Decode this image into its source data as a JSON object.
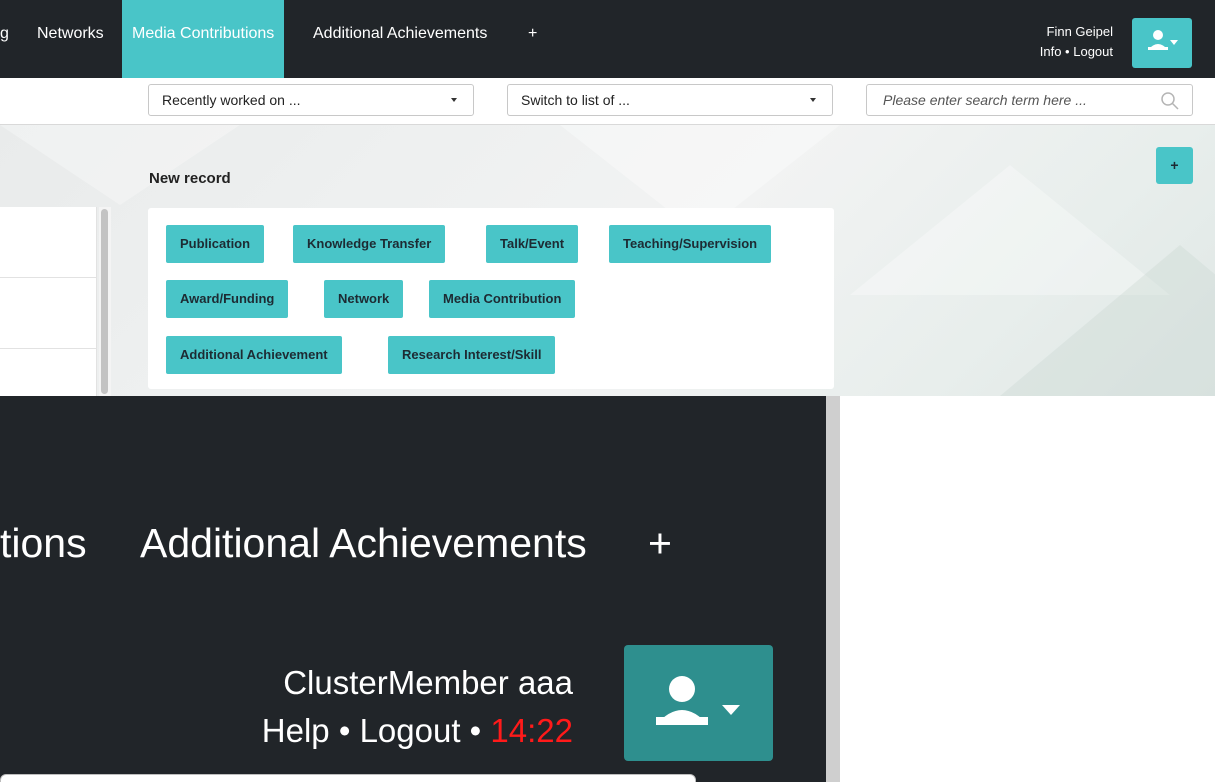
{
  "navbar": {
    "items": [
      {
        "label": "g"
      },
      {
        "label": "Networks"
      },
      {
        "label": "Media Contributions",
        "active": true
      },
      {
        "label": "Additional Achievements"
      },
      {
        "label": "+"
      }
    ],
    "user": {
      "name": "Finn Geipel",
      "info": "Info",
      "separator": "•",
      "logout": "Logout"
    },
    "user_button_icon": "user-icon",
    "accent_color": "#49c5c8",
    "bar_color": "#212529"
  },
  "subbar": {
    "recent_select": {
      "value": "Recently worked on ..."
    },
    "switch_select": {
      "value": "Switch to list of ..."
    },
    "search": {
      "placeholder": "Please enter search term here ..."
    }
  },
  "new_record": {
    "title": "New record",
    "add_button": "+",
    "buttons": [
      {
        "label": "Publication"
      },
      {
        "label": "Knowledge Transfer"
      },
      {
        "label": "Talk/Event"
      },
      {
        "label": "Teaching/Supervision"
      },
      {
        "label": "Award/Funding"
      },
      {
        "label": "Network"
      },
      {
        "label": "Media Contribution"
      },
      {
        "label": "Additional Achievement"
      },
      {
        "label": "Research Interest/Skill"
      }
    ]
  },
  "zoom": {
    "nav": [
      {
        "label": "tions"
      },
      {
        "label": "Additional Achievements"
      },
      {
        "label": "+"
      }
    ],
    "user_name": "ClusterMember aaa",
    "help": "Help",
    "separator": "•",
    "logout": "Logout",
    "time": "14:22",
    "time_color": "#ff1a1a",
    "button_color": "#2e8f8e"
  }
}
